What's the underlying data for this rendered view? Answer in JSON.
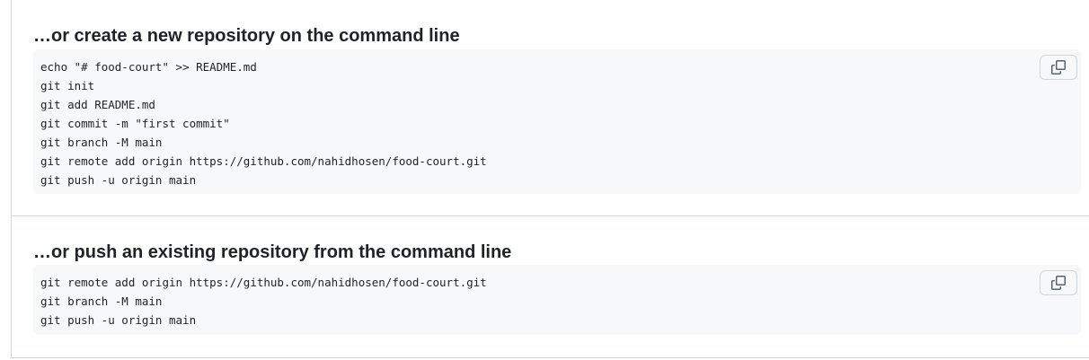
{
  "sections": [
    {
      "heading": "…or create a new repository on the command line",
      "code_lines": [
        "echo \"# food-court\" >> README.md",
        "git init",
        "git add README.md",
        "git commit -m \"first commit\"",
        "git branch -M main",
        "git remote add origin https://github.com/nahidhosen/food-court.git",
        "git push -u origin main"
      ],
      "copy_icon": "copy-icon"
    },
    {
      "heading": "…or push an existing repository from the command line",
      "code_lines": [
        "git remote add origin https://github.com/nahidhosen/food-court.git",
        "git branch -M main",
        "git push -u origin main"
      ],
      "copy_icon": "copy-icon"
    }
  ],
  "colors": {
    "text": "#1f2328",
    "border": "#d0d7de",
    "code_background": "#f6f8fa",
    "icon": "#59636e"
  }
}
